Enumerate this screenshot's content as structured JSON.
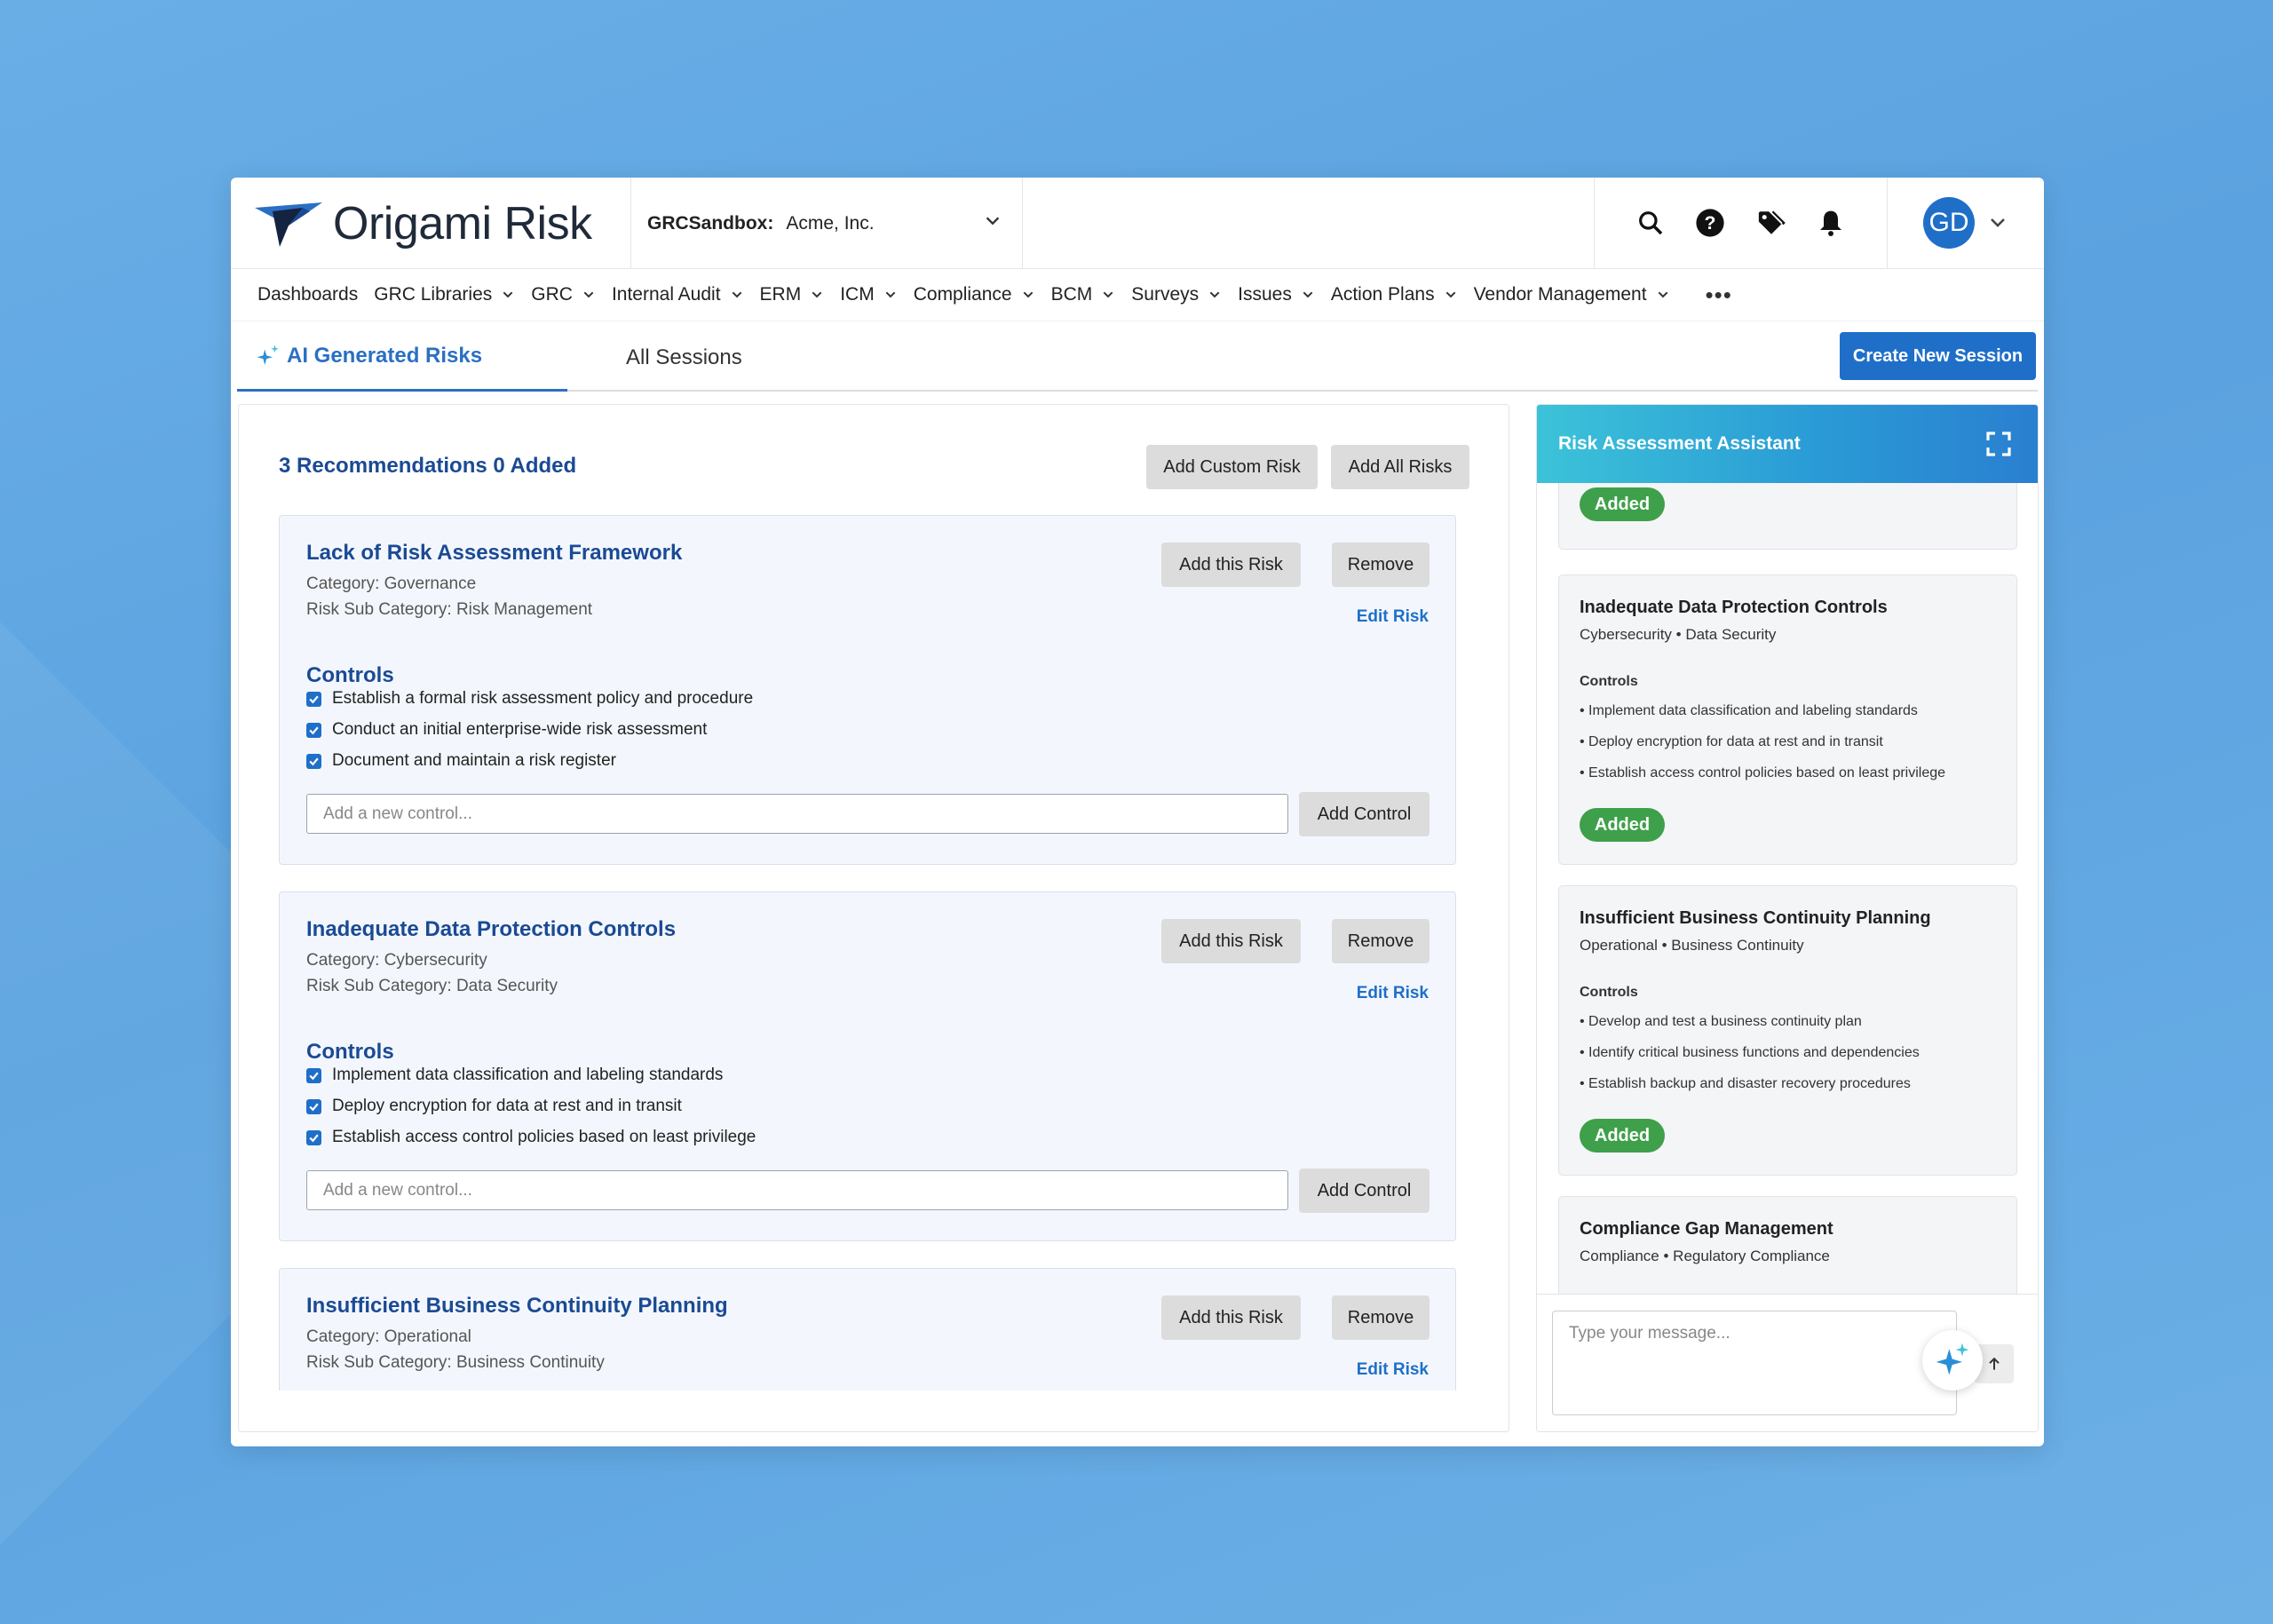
{
  "header": {
    "logo_text": "Origami Risk",
    "env_label": "GRCSandbox:",
    "env_value": "Acme, Inc.",
    "icons": [
      "search-icon",
      "help-icon",
      "tag-icon",
      "bell-icon"
    ],
    "avatar_initials": "GD"
  },
  "nav": {
    "items": [
      {
        "label": "Dashboards",
        "dropdown": false
      },
      {
        "label": "GRC Libraries",
        "dropdown": true
      },
      {
        "label": "GRC",
        "dropdown": true
      },
      {
        "label": "Internal Audit",
        "dropdown": true
      },
      {
        "label": "ERM",
        "dropdown": true
      },
      {
        "label": "ICM",
        "dropdown": true
      },
      {
        "label": "Compliance",
        "dropdown": true
      },
      {
        "label": "BCM",
        "dropdown": true
      },
      {
        "label": "Surveys",
        "dropdown": true
      },
      {
        "label": "Issues",
        "dropdown": true
      },
      {
        "label": "Action Plans",
        "dropdown": true
      },
      {
        "label": "Vendor Management",
        "dropdown": true
      }
    ],
    "more": "•••"
  },
  "tabs": {
    "ai_generated": "AI Generated Risks",
    "all_sessions": "All Sessions",
    "create_button": "Create New Session"
  },
  "recommendations": {
    "summary": "3 Recommendations 0 Added",
    "add_custom": "Add Custom Risk",
    "add_all": "Add All Risks",
    "add_risk_label": "Add this Risk",
    "remove_label": "Remove",
    "edit_label": "Edit Risk",
    "controls_heading": "Controls",
    "add_control_label": "Add Control",
    "new_control_placeholder": "Add a new control...",
    "risks": [
      {
        "title": "Lack of Risk Assessment Framework",
        "category": "Category: Governance",
        "sub_category": "Risk Sub Category: Risk Management",
        "controls": [
          "Establish a formal risk assessment policy and procedure",
          "Conduct an initial enterprise-wide risk assessment",
          "Document and maintain a risk register"
        ]
      },
      {
        "title": "Inadequate Data Protection Controls",
        "category": "Category: Cybersecurity",
        "sub_category": "Risk Sub Category: Data Security",
        "controls": [
          "Implement data classification and labeling standards",
          "Deploy encryption for data at rest and in transit",
          "Establish access control policies based on least privilege"
        ]
      },
      {
        "title": "Insufficient Business Continuity Planning",
        "category": "Category: Operational",
        "sub_category": "Risk Sub Category: Business Continuity",
        "controls": []
      }
    ]
  },
  "assistant": {
    "title": "Risk Assessment Assistant",
    "added_label": "Added",
    "controls_heading": "Controls",
    "cards": [
      {
        "title": "Inadequate Data Protection Controls",
        "category": "Cybersecurity • Data Security",
        "controls": [
          "• Implement data classification and labeling standards",
          "• Deploy encryption for data at rest and in transit",
          "• Establish access control policies based on least privilege"
        ]
      },
      {
        "title": "Insufficient Business Continuity Planning",
        "category": "Operational • Business Continuity",
        "controls": [
          "• Develop and test a business continuity plan",
          "• Identify critical business functions and dependencies",
          "• Establish backup and disaster recovery procedures"
        ]
      },
      {
        "title": "Compliance Gap Management",
        "category": "Compliance • Regulatory Compliance",
        "controls": []
      }
    ],
    "message_placeholder": "Type your message..."
  },
  "colors": {
    "primary": "#1f6fc9",
    "heading_blue": "#1b4a94",
    "added_green": "#3ea04a"
  }
}
